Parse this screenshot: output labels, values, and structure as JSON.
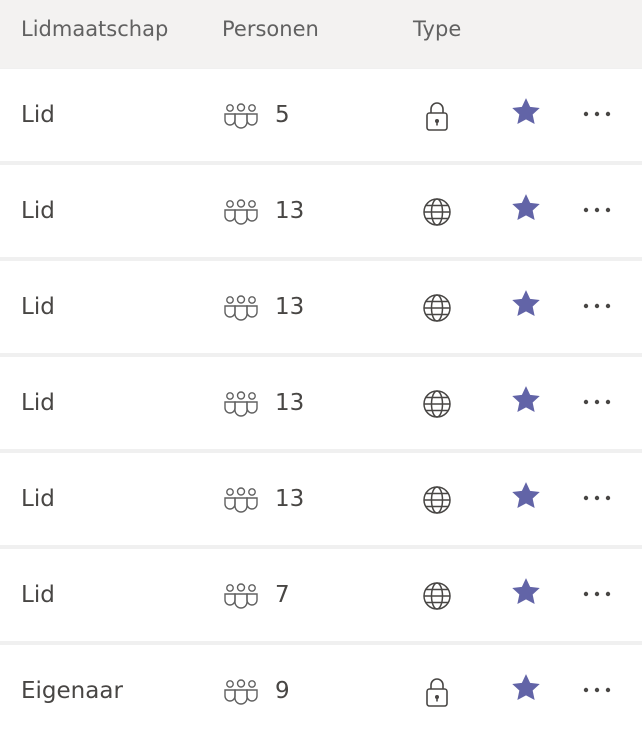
{
  "header": {
    "col_membership": "Lidmaatschap",
    "col_people": "Personen",
    "col_type": "Type"
  },
  "colors": {
    "star": "#6264a7",
    "text": "#484644",
    "header_bg": "#f3f2f1",
    "row_bg": "#ffffff"
  },
  "rows": [
    {
      "membership": "Lid",
      "people": "5",
      "type": "lock-icon",
      "favorite": true
    },
    {
      "membership": "Lid",
      "people": "13",
      "type": "globe-icon",
      "favorite": true
    },
    {
      "membership": "Lid",
      "people": "13",
      "type": "globe-icon",
      "favorite": true
    },
    {
      "membership": "Lid",
      "people": "13",
      "type": "globe-icon",
      "favorite": true
    },
    {
      "membership": "Lid",
      "people": "13",
      "type": "globe-icon",
      "favorite": true
    },
    {
      "membership": "Lid",
      "people": "7",
      "type": "globe-icon",
      "favorite": true
    },
    {
      "membership": "Eigenaar",
      "people": "9",
      "type": "lock-icon",
      "favorite": true
    }
  ]
}
